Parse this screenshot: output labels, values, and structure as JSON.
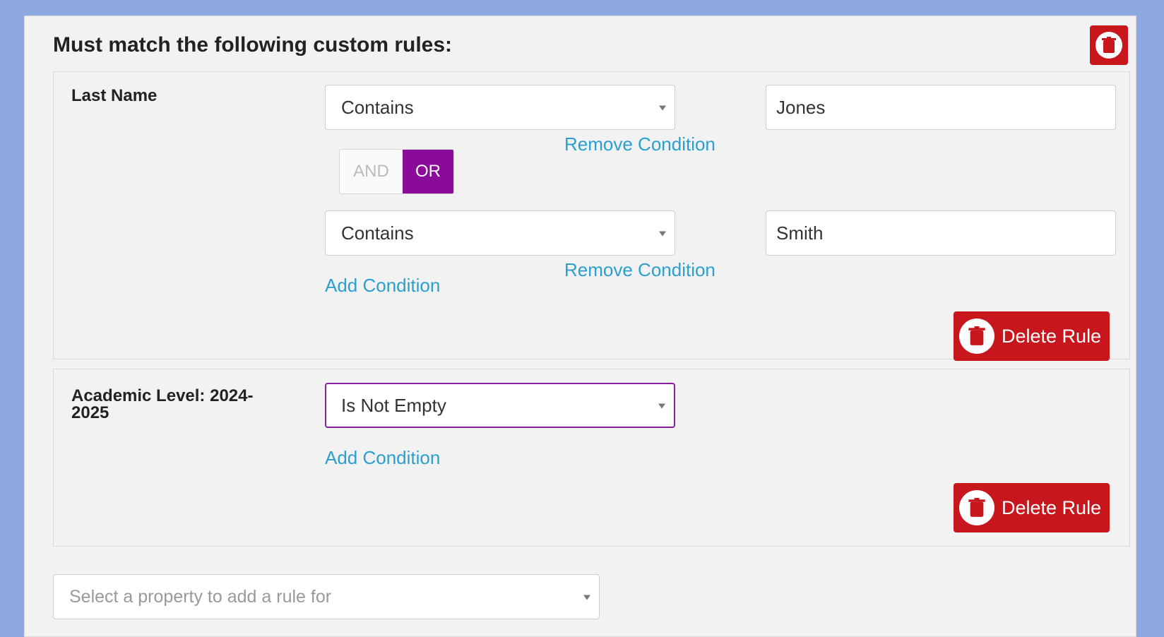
{
  "panel": {
    "title": "Must match the following custom rules:"
  },
  "rules": [
    {
      "label": "Last Name",
      "conditions": [
        {
          "operator": "Contains",
          "value": "Jones",
          "remove_label": "Remove Condition"
        },
        {
          "operator": "Contains",
          "value": "Smith",
          "remove_label": "Remove Condition"
        }
      ],
      "logic": {
        "and_label": "AND",
        "or_label": "OR",
        "selected": "OR"
      },
      "add_label": "Add Condition",
      "delete_label": "Delete Rule"
    },
    {
      "label": "Academic Level: 2024-2025",
      "label_line1": "Academic Level: 2024-",
      "label_line2": "2025",
      "conditions": [
        {
          "operator": "Is Not Empty"
        }
      ],
      "add_label": "Add Condition",
      "delete_label": "Delete Rule"
    }
  ],
  "property_select": {
    "placeholder": "Select a property to add a rule for"
  },
  "colors": {
    "delete_red": "#c8161d",
    "accent_purple": "#8a0a9a",
    "link_blue": "#2a9fd0"
  }
}
